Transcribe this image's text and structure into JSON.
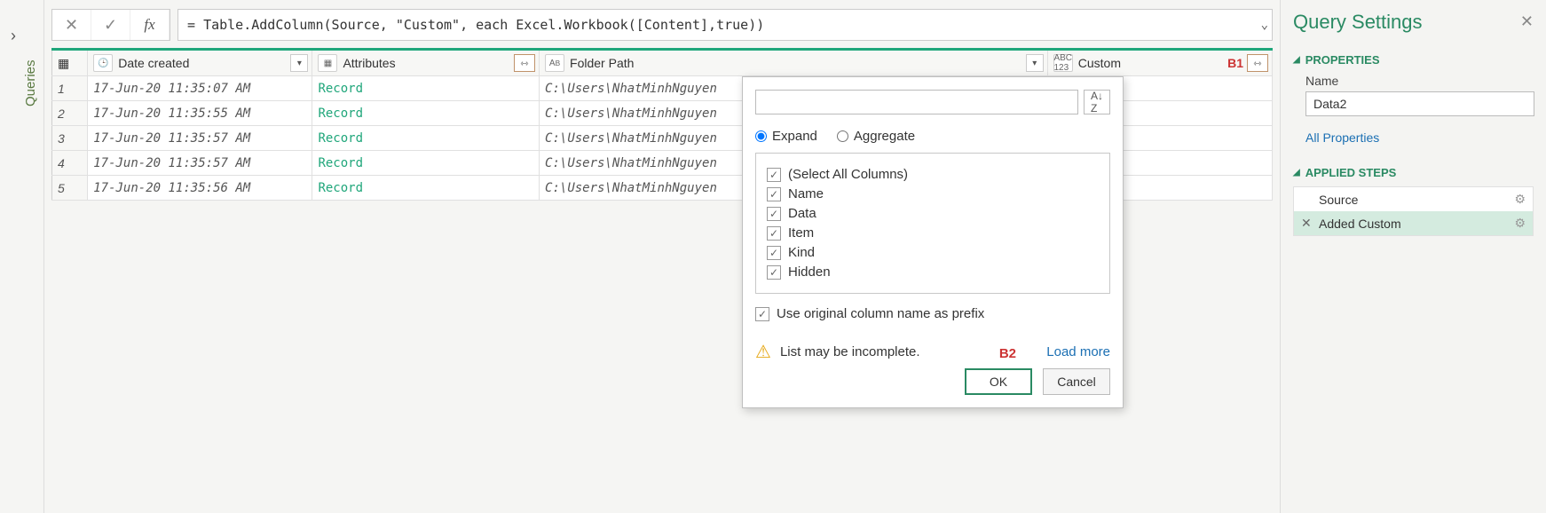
{
  "sidebar": {
    "label": "Queries"
  },
  "formula": {
    "prefix": "= ",
    "fn1": "Table.AddColumn",
    "open": "(Source, ",
    "str": "\"Custom\"",
    "mid": ", each ",
    "fn2": "Excel.Workbook",
    "args": "([Content],",
    "true": "true",
    "close": "))"
  },
  "columns": {
    "dateCreated": "Date created",
    "attributes": "Attributes",
    "folderPath": "Folder Path",
    "custom": "Custom"
  },
  "badges": {
    "b1": "B1",
    "b2": "B2"
  },
  "rows": [
    {
      "n": "1",
      "date": "17-Jun-20 11:35:07 AM",
      "attr": "Record",
      "path": "C:\\Users\\NhatMinhNguyen"
    },
    {
      "n": "2",
      "date": "17-Jun-20 11:35:55 AM",
      "attr": "Record",
      "path": "C:\\Users\\NhatMinhNguyen"
    },
    {
      "n": "3",
      "date": "17-Jun-20 11:35:57 AM",
      "attr": "Record",
      "path": "C:\\Users\\NhatMinhNguyen"
    },
    {
      "n": "4",
      "date": "17-Jun-20 11:35:57 AM",
      "attr": "Record",
      "path": "C:\\Users\\NhatMinhNguyen"
    },
    {
      "n": "5",
      "date": "17-Jun-20 11:35:56 AM",
      "attr": "Record",
      "path": "C:\\Users\\NhatMinhNguyen"
    }
  ],
  "popup": {
    "searchPlaceholder": "",
    "expand": "Expand",
    "aggregate": "Aggregate",
    "selectAll": "(Select All Columns)",
    "cols": [
      "Name",
      "Data",
      "Item",
      "Kind",
      "Hidden"
    ],
    "prefix": "Use original column name as prefix",
    "warn": "List may be incomplete.",
    "loadMore": "Load more",
    "ok": "OK",
    "cancel": "Cancel"
  },
  "settings": {
    "title": "Query Settings",
    "properties": "PROPERTIES",
    "nameLabel": "Name",
    "nameValue": "Data2",
    "allProps": "All Properties",
    "appliedSteps": "APPLIED STEPS",
    "steps": [
      {
        "label": "Source",
        "selected": false
      },
      {
        "label": "Added Custom",
        "selected": true
      }
    ]
  }
}
